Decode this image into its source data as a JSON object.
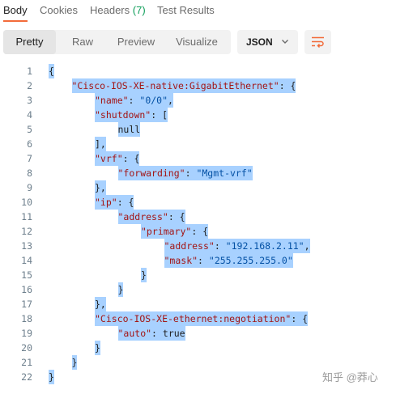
{
  "tabs": [
    {
      "label": "Body"
    },
    {
      "label": "Cookies"
    },
    {
      "label": "Headers",
      "count": "(7)"
    },
    {
      "label": "Test Results"
    }
  ],
  "view_modes": [
    "Pretty",
    "Raw",
    "Preview",
    "Visualize"
  ],
  "format": {
    "label": "JSON"
  },
  "icons": {
    "dropdown": "chevron-down-icon",
    "wrap": "wrap-lines-icon"
  },
  "colors": {
    "accent": "#f26b3a",
    "selection": "#a8d1ff",
    "key": "#a31515",
    "string": "#0451a5"
  },
  "code_lines": [
    {
      "n": "1",
      "text": "{"
    },
    {
      "n": "2",
      "key": "\"Cisco-IOS-XE-native:GigabitEthernet\"",
      "rest": ": {"
    },
    {
      "n": "3",
      "key": "\"name\"",
      "rest": ": ",
      "val": "\"0/0\"",
      "tail": ","
    },
    {
      "n": "4",
      "key": "\"shutdown\"",
      "rest": ": ["
    },
    {
      "n": "5",
      "lit": "null"
    },
    {
      "n": "6",
      "text": "],"
    },
    {
      "n": "7",
      "key": "\"vrf\"",
      "rest": ": {"
    },
    {
      "n": "8",
      "key": "\"forwarding\"",
      "rest": ": ",
      "val": "\"Mgmt-vrf\""
    },
    {
      "n": "9",
      "text": "},"
    },
    {
      "n": "10",
      "key": "\"ip\"",
      "rest": ": {"
    },
    {
      "n": "11",
      "key": "\"address\"",
      "rest": ": {"
    },
    {
      "n": "12",
      "key": "\"primary\"",
      "rest": ": {"
    },
    {
      "n": "13",
      "key": "\"address\"",
      "rest": ": ",
      "val": "\"192.168.2.11\"",
      "tail": ","
    },
    {
      "n": "14",
      "key": "\"mask\"",
      "rest": ": ",
      "val": "\"255.255.255.0\""
    },
    {
      "n": "15",
      "text": "}"
    },
    {
      "n": "16",
      "text": "}"
    },
    {
      "n": "17",
      "text": "},"
    },
    {
      "n": "18",
      "key": "\"Cisco-IOS-XE-ethernet:negotiation\"",
      "rest": ": {"
    },
    {
      "n": "19",
      "key": "\"auto\"",
      "rest": ": ",
      "lit": "true"
    },
    {
      "n": "20",
      "text": "}"
    },
    {
      "n": "21",
      "text": "}"
    },
    {
      "n": "22",
      "text": "}"
    }
  ],
  "watermark": "知乎 @莽心"
}
